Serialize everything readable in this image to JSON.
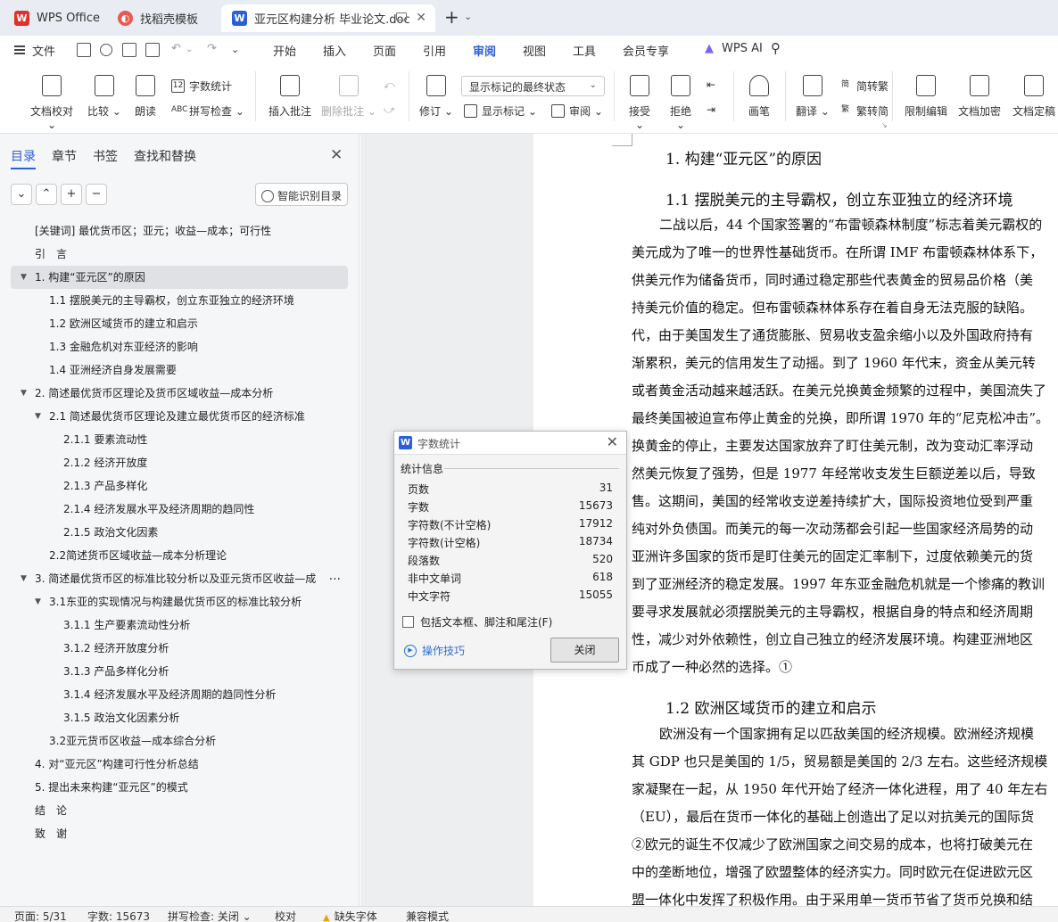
{
  "tabs": [
    {
      "label": "WPS Office",
      "icon": "wps-logo-icon"
    },
    {
      "label": "找稻壳模板",
      "icon": "docer-icon"
    },
    {
      "label": "亚元区构建分析 毕业论文.doc",
      "icon": "word-doc-icon",
      "active": true
    }
  ],
  "menu": {
    "file": "文件",
    "items": [
      "开始",
      "插入",
      "页面",
      "引用",
      "审阅",
      "视图",
      "工具",
      "会员专享"
    ],
    "active": "审阅",
    "ai": "WPS AI"
  },
  "ribbon": {
    "doc_check": "文档校对",
    "compare": "比较",
    "read_aloud": "朗读",
    "word_count": "字数统计",
    "spell_check": "拼写检查",
    "insert_comment": "插入批注",
    "delete_comment": "删除批注",
    "revise": "修订",
    "markup_select": "显示标记的最终状态",
    "show_markup": "显示标记",
    "review": "审阅",
    "accept": "接受",
    "reject": "拒绝",
    "pen": "画笔",
    "translate": "翻译",
    "trad_simp": "简转繁",
    "simp_trad": "繁转简",
    "restrict_edit": "限制编辑",
    "doc_encrypt": "文档加密",
    "doc_finalize": "文档定稿"
  },
  "nav": {
    "tabs": [
      "目录",
      "章节",
      "书签",
      "查找和替换"
    ],
    "active_tab": "目录",
    "smart_btn": "智能识别目录",
    "toc": [
      {
        "text": "[关键词] 最优货币区；亚元；收益—成本；可行性",
        "level": 1
      },
      {
        "text": "引　言",
        "level": 1
      },
      {
        "text": "1.  构建“亚元区”的原因",
        "level": 1,
        "expand": true,
        "selected": true
      },
      {
        "text": "1.1    摆脱美元的主导霸权，创立东亚独立的经济环境",
        "level": 2
      },
      {
        "text": "1.2    欧洲区域货币的建立和启示",
        "level": 2
      },
      {
        "text": "1.3    金融危机对东亚经济的影响",
        "level": 2
      },
      {
        "text": "1.4    亚洲经济自身发展需要",
        "level": 2
      },
      {
        "text": "2.  简述最优货币区理论及货币区域收益—成本分析",
        "level": 1,
        "expand": true
      },
      {
        "text": "2.1  简述最优货币区理论及建立最优货币区的经济标准",
        "level": 2,
        "expand": true
      },
      {
        "text": "2.1.1    要素流动性",
        "level": 3
      },
      {
        "text": "2.1.2    经济开放度",
        "level": 3
      },
      {
        "text": "2.1.3    产品多样化",
        "level": 3
      },
      {
        "text": "2.1.4    经济发展水平及经济周期的趋同性",
        "level": 3
      },
      {
        "text": "2.1.5    政治文化因素",
        "level": 3
      },
      {
        "text": "2.2简述货币区域收益—成本分析理论",
        "level": 2
      },
      {
        "text": "3.  简述最优货币区的标准比较分析以及亚元货币区收益—成",
        "level": 1,
        "expand": true,
        "more": "..."
      },
      {
        "text": "3.1东亚的实现情况与构建最优货币区的标准比较分析",
        "level": 2,
        "expand": true
      },
      {
        "text": "3.1.1    生产要素流动性分析",
        "level": 3
      },
      {
        "text": "3.1.2    经济开放度分析",
        "level": 3
      },
      {
        "text": "3.1.3    产品多样化分析",
        "level": 3
      },
      {
        "text": "3.1.4    经济发展水平及经济周期的趋同性分析",
        "level": 3
      },
      {
        "text": "3.1.5    政治文化因素分析",
        "level": 3
      },
      {
        "text": "3.2亚元货币区收益—成本综合分析",
        "level": 2
      },
      {
        "text": "4.  对“亚元区”构建可行性分析总结",
        "level": 1
      },
      {
        "text": "5.  提出未来构建“亚元区”的模式",
        "level": 1
      },
      {
        "text": "结　论",
        "level": 1
      },
      {
        "text": "致　谢",
        "level": 1
      }
    ]
  },
  "document": {
    "heading1": "1.  构建“亚元区”的原因",
    "heading2a": "1.1    摆脱美元的主导霸权，创立东亚独立的经济环境",
    "para1": [
      "二战以后，44 个国家签署的“布雷顿森林制度”标志着美元霸权的",
      "美元成为了唯一的世界性基础货币。在所谓 IMF 布雷顿森林体系下，",
      "供美元作为储备货币，同时通过稳定那些代表黄金的贸易品价格（美",
      "持美元价值的稳定。但布雷顿森林体系存在着自身无法克服的缺陷。",
      "代，由于美国发生了通货膨胀、贸易收支盈余缩小以及外国政府持有",
      "渐累积，美元的信用发生了动摇。到了 1960 年代末，资金从美元转",
      "或者黄金活动越来越活跃。在美元兑换黄金频繁的过程中，美国流失了",
      "最终美国被迫宣布停止黄金的兑换，即所谓 1970 年的“尼克松冲击”。",
      "换黄金的停止，主要发达国家放弃了盯住美元制，改为变动汇率浮动",
      "然美元恢复了强势，但是 1977 年经常收支发生巨额逆差以后，导致",
      "售。这期间，美国的经常收支逆差持续扩大，国际投资地位受到严重",
      "纯对外负债国。而美元的每一次动荡都会引起一些国家经济局势的动",
      "亚洲许多国家的货币是盯住美元的固定汇率制下，过度依赖美元的货",
      "到了亚洲经济的稳定发展。1997 年东亚金融危机就是一个惨痛的教训",
      "要寻求发展就必须摆脱美元的主导霸权，根据自身的特点和经济周期",
      "性，减少对外依赖性，创立自己独立的经济发展环境。构建亚洲地区",
      "币成了一种必然的选择。①"
    ],
    "heading2b": "1.2    欧洲区域货币的建立和启示",
    "para2": [
      "欧洲没有一个国家拥有足以匹敌美国的经济规模。欧洲经济规模",
      "其 GDP 也只是美国的 1/5，贸易额是美国的 2/3 左右。这些经济规模",
      "家凝聚在一起，从 1950 年代开始了经济一体化进程，用了 40 年左右",
      "（EU），最后在货币一体化的基础上创造出了足以对抗美元的国际货",
      "②欧元的诞生不仅减少了欧洲国家之间交易的成本，也将打破美元在",
      "中的垄断地位，增强了欧盟整体的经济实力。同时欧元在促进欧元区",
      "盟一体化中发挥了积极作用。由于采用单一货币节省了货币兑换和结"
    ]
  },
  "dialog": {
    "title": "字数统计",
    "section": "统计信息",
    "stats": [
      {
        "label": "页数",
        "value": "31"
      },
      {
        "label": "字数",
        "value": "15673"
      },
      {
        "label": "字符数(不计空格)",
        "value": "17912"
      },
      {
        "label": "字符数(计空格)",
        "value": "18734"
      },
      {
        "label": "段落数",
        "value": "520"
      },
      {
        "label": "非中文单词",
        "value": "618"
      },
      {
        "label": "中文字符",
        "value": "15055"
      }
    ],
    "checkbox": "包括文本框、脚注和尾注(F)",
    "tips": "操作技巧",
    "close": "关闭"
  },
  "status": {
    "page": "页面: 5/31",
    "words": "字数: 15673",
    "spell": "拼写检查: 关闭",
    "proof": "校对",
    "missing_font": "缺失字体",
    "compat": "兼容模式"
  }
}
